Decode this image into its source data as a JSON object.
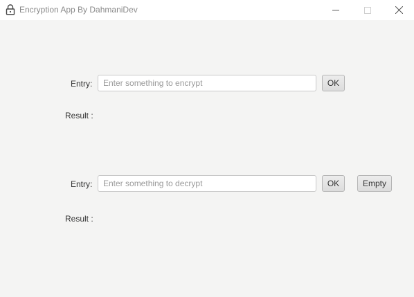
{
  "window": {
    "title": "Encryption App By DahmaniDev",
    "app_icon": "lock-icon",
    "controls": [
      "minimize-icon",
      "maximize-icon",
      "close-icon"
    ]
  },
  "encrypt": {
    "entry_label": "Entry:",
    "placeholder": "Enter something to encrypt",
    "value": "",
    "ok_label": "OK",
    "result_label": "Result :"
  },
  "decrypt": {
    "entry_label": "Entry:",
    "placeholder": "Enter something to decrypt",
    "value": "",
    "ok_label": "OK",
    "empty_label": "Empty",
    "result_label": "Result :"
  }
}
